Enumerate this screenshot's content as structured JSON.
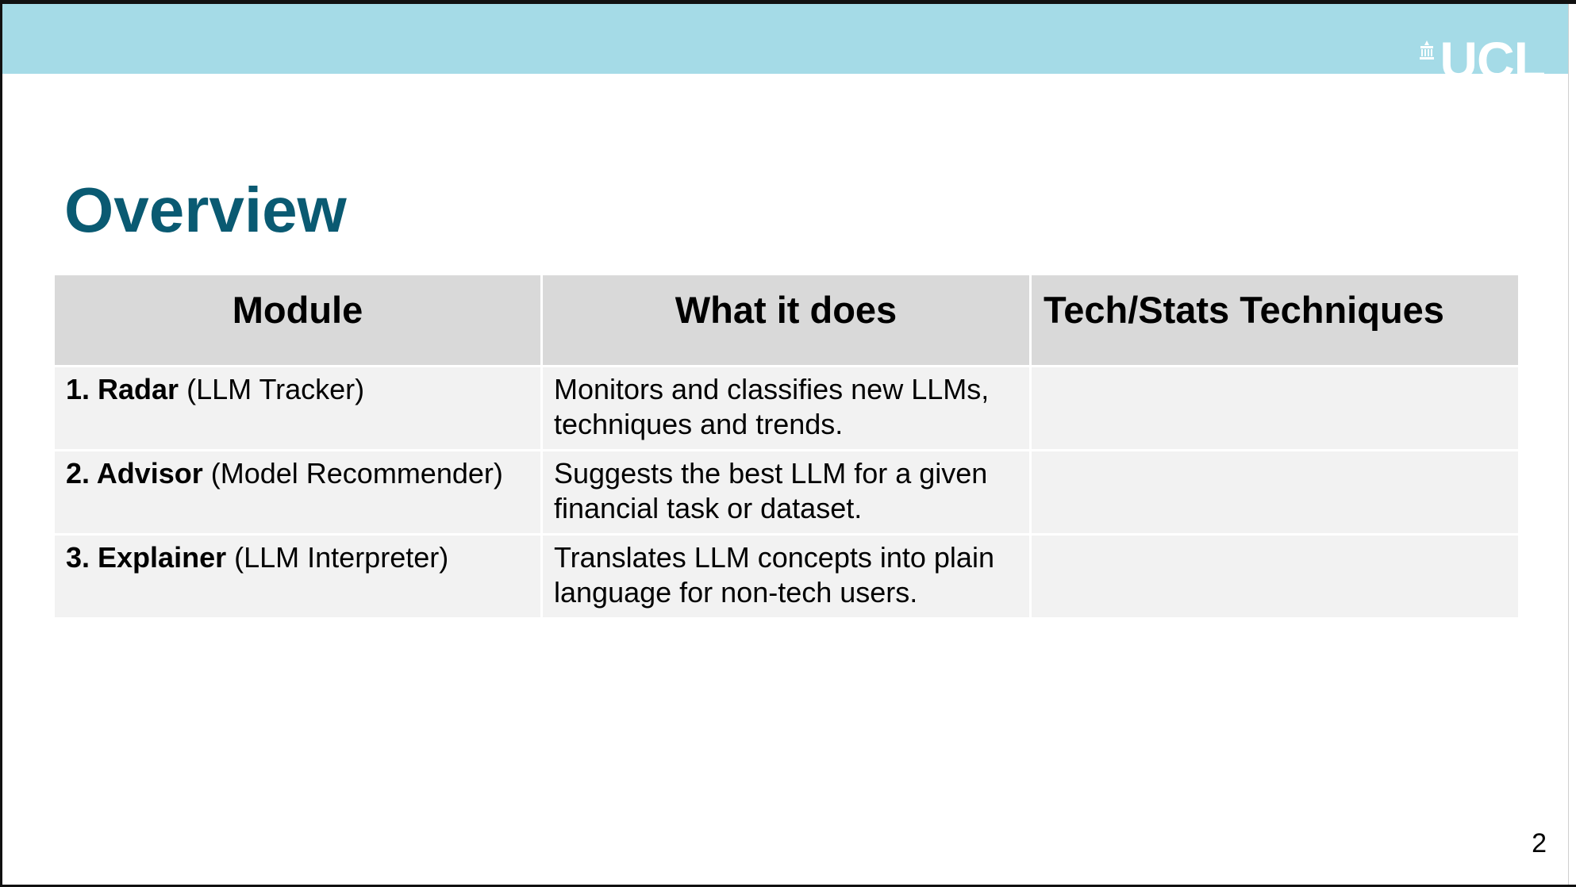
{
  "brand": {
    "logo_text": "UCL",
    "header_color": "#a5dbe7",
    "title_color": "#0a5a72"
  },
  "slide": {
    "title": "Overview",
    "page_number": "2"
  },
  "table": {
    "headers": [
      "Module",
      "What it does",
      "Tech/Stats Techniques"
    ],
    "rows": [
      {
        "name": "1. Radar",
        "sub": "(LLM Tracker)",
        "does": "Monitors and classifies new LLMs, techniques and trends.",
        "tech": ""
      },
      {
        "name": "2. Advisor",
        "sub": "(Model Recommender)",
        "does": "Suggests the best LLM for a given financial task or dataset.",
        "tech": ""
      },
      {
        "name": "3. Explainer",
        "sub": "(LLM Interpreter)",
        "does": "Translates LLM concepts into plain language for non-tech users.",
        "tech": ""
      }
    ]
  }
}
